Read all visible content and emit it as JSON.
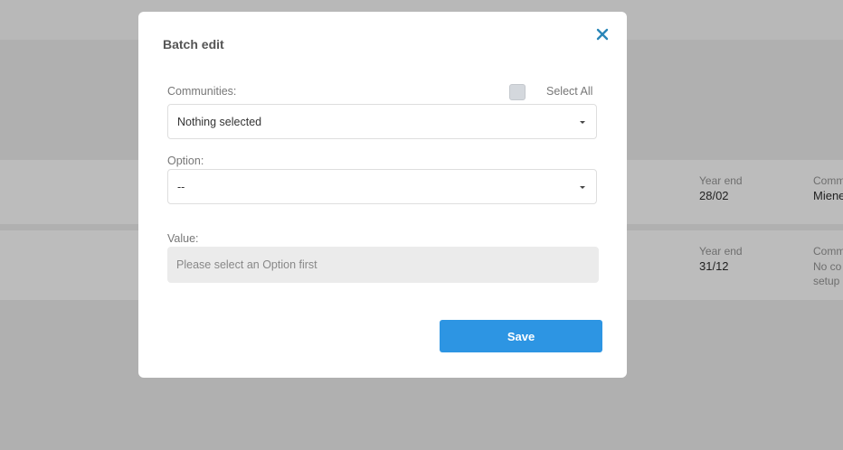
{
  "background": {
    "rows": [
      {
        "year_end_label": "Year end",
        "year_end_value": "28/02",
        "comm_label": "Comm",
        "comm_value": "Miene"
      },
      {
        "year_end_label": "Year end",
        "year_end_value": "31/12",
        "comm_label": "Comm",
        "comm_value_line1": "No co",
        "comm_value_line2": "setup"
      }
    ]
  },
  "modal": {
    "title": "Batch edit",
    "close_icon": "close-x-icon",
    "communities": {
      "label": "Communities:",
      "select_all_label": "Select All",
      "selected_text": "Nothing selected"
    },
    "option": {
      "label": "Option:",
      "selected_text": "--"
    },
    "value": {
      "label": "Value:",
      "placeholder": "Please select an Option first"
    },
    "save_label": "Save"
  },
  "colors": {
    "accent": "#2d95e3",
    "close_icon": "#2a86b8",
    "overlay": "#b0b0b0"
  }
}
